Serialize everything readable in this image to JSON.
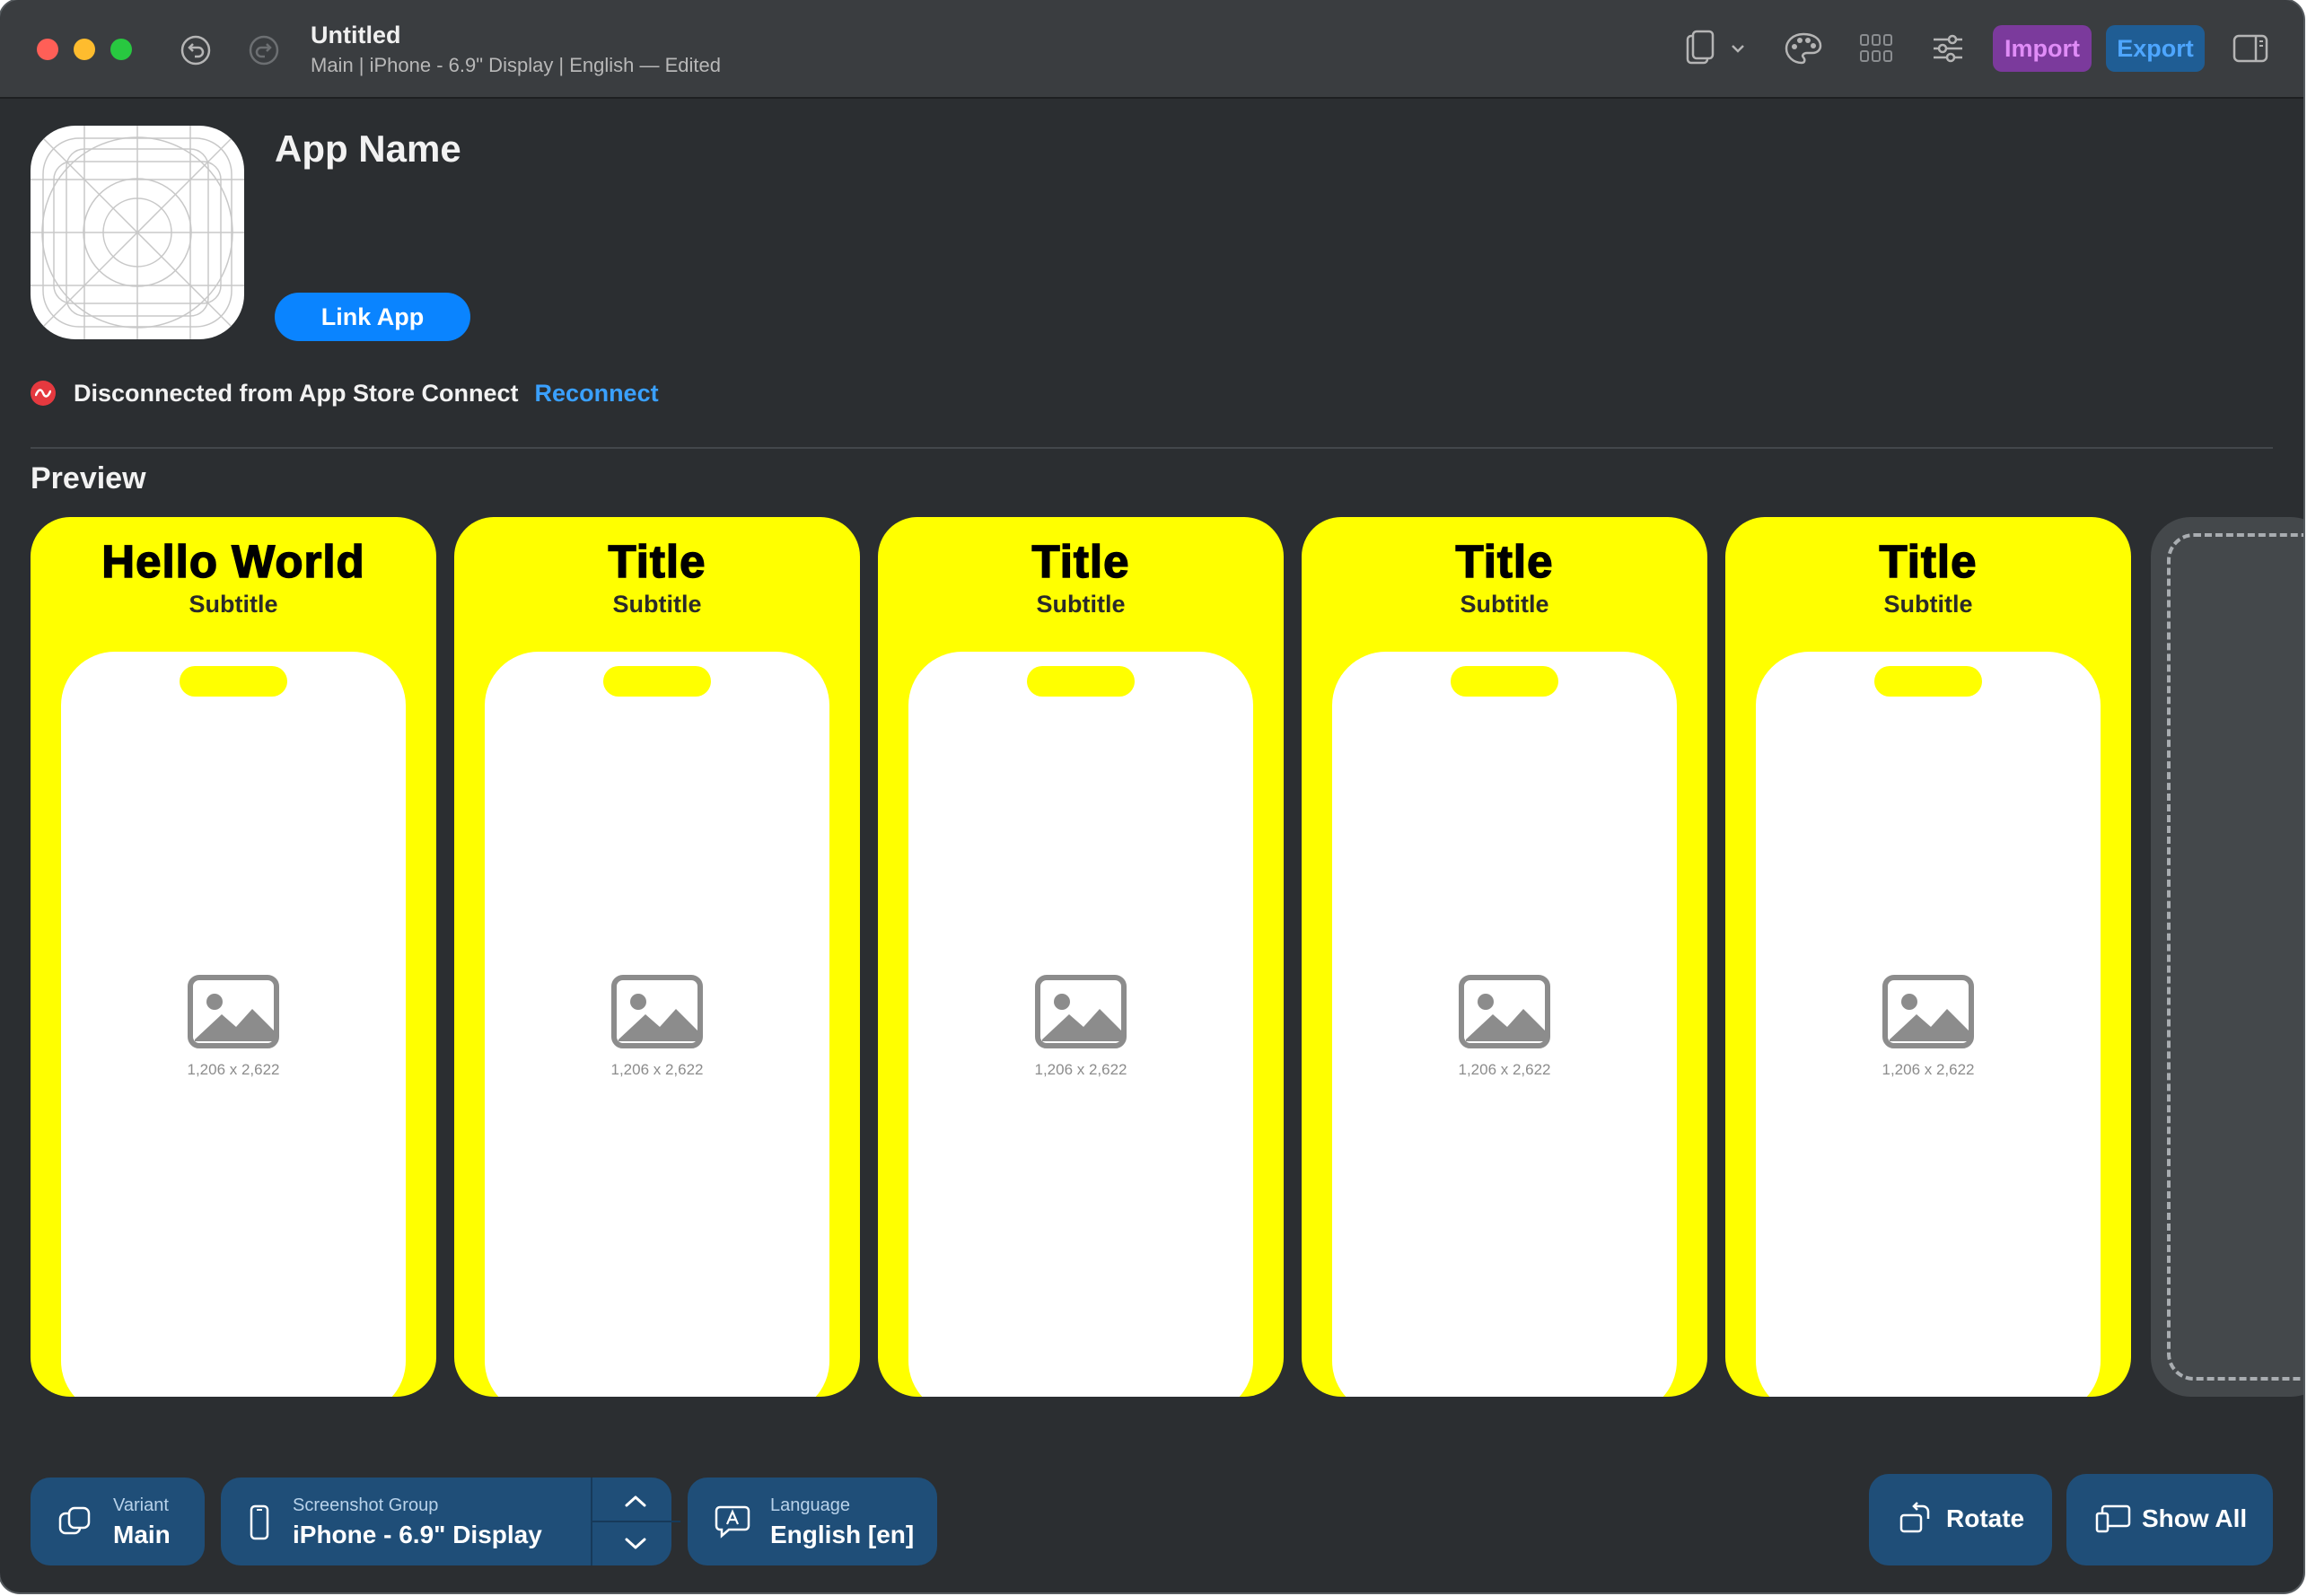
{
  "window": {
    "title": "Untitled",
    "subtitle": "Main | iPhone - 6.9\" Display | English — Edited"
  },
  "toolbar": {
    "import_label": "Import",
    "export_label": "Export",
    "icons": [
      "undo-icon",
      "redo-icon",
      "device-frame-icon",
      "palette-icon",
      "grid-icon",
      "sliders-icon",
      "sidebar-icon"
    ]
  },
  "app": {
    "name": "App Name",
    "link_label": "Link App"
  },
  "status": {
    "message": "Disconnected from App Store Connect",
    "action": "Reconnect"
  },
  "preview": {
    "heading": "Preview",
    "cards": [
      {
        "title": "Hello World",
        "subtitle": "Subtitle",
        "dimensions": "1,206 x 2,622"
      },
      {
        "title": "Title",
        "subtitle": "Subtitle",
        "dimensions": "1,206 x 2,622"
      },
      {
        "title": "Title",
        "subtitle": "Subtitle",
        "dimensions": "1,206 x 2,622"
      },
      {
        "title": "Title",
        "subtitle": "Subtitle",
        "dimensions": "1,206 x 2,622"
      },
      {
        "title": "Title",
        "subtitle": "Subtitle",
        "dimensions": "1,206 x 2,622"
      }
    ]
  },
  "bottom": {
    "variant": {
      "label": "Variant",
      "value": "Main"
    },
    "screenshot_group": {
      "label": "Screenshot Group",
      "value": "iPhone - 6.9\" Display"
    },
    "language": {
      "label": "Language",
      "value": "English [en]"
    },
    "rotate_label": "Rotate",
    "show_all_label": "Show All"
  },
  "colors": {
    "card_background": "#ffff00",
    "accent_blue": "#0a84ff",
    "import_purple": "#7b3a9c",
    "control_blue": "#1f4e78",
    "window_background": "#2b2e31"
  }
}
